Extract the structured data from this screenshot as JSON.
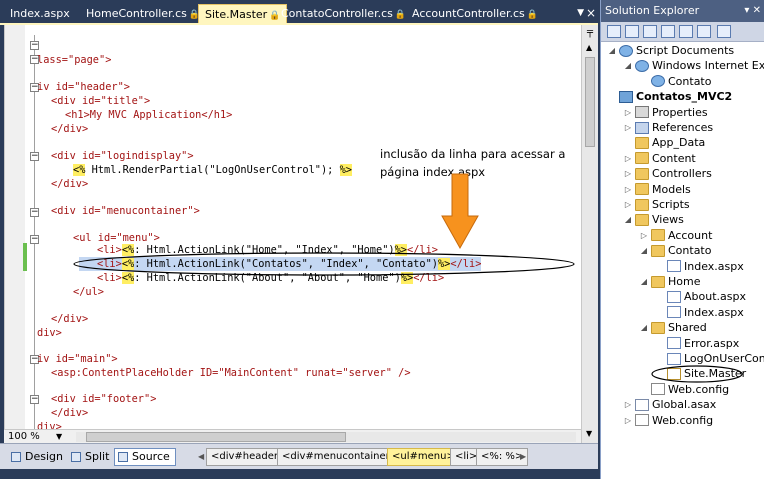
{
  "tabs": [
    {
      "label": "Index.aspx",
      "locked": false
    },
    {
      "label": "HomeController.cs",
      "locked": true
    },
    {
      "label": "Site.Master",
      "locked": true,
      "active": true
    },
    {
      "label": "ContatoController.cs",
      "locked": true
    },
    {
      "label": "AccountController.cs",
      "locked": true
    }
  ],
  "tab_lock_glyph": "🔒",
  "tab_dropdown_glyph": "▼",
  "tab_close_glyph": "×",
  "code": {
    "l1_a": "lass=\"page\">",
    "l2_a": "iv id=\"header\">",
    "l3_a": "<div id=\"title\">",
    "l4_a": "<h1>My MVC Application</h1>",
    "l5_a": "</div>",
    "l6_a": "<div id=\"logindisplay\">",
    "l7_open": "<%",
    "l7_mid": " Html.RenderPartial(\"LogOnUserControl\"); ",
    "l7_close": "%>",
    "l8_a": "</div>",
    "l9_a": "<div id=\"menucontainer\">",
    "l10_a": "<ul id=\"menu\">",
    "l11_pre": "<li>",
    "l11_open": "<%",
    "l11_mid": ": Html.ActionLink(\"Home\", \"Index\", \"Home\")",
    "l11_close": "%>",
    "l11_post": "</li>",
    "l12_pre": "<li>",
    "l12_open": "<%",
    "l12_mid": ": Html.ActionLink(\"Contatos\", \"Index\", \"Contato\")",
    "l12_close": "%>",
    "l12_post": "</li>",
    "l13_pre": "<li>",
    "l13_open": "<%",
    "l13_mid": ": Html.ActionLink(\"About\", \"About\", \"Home\")",
    "l13_close": "%>",
    "l13_post": "</li>",
    "l14_a": "</ul>",
    "l15_a": "</div>",
    "l16_a": "div>",
    "l17_a": "iv id=\"main\">",
    "l18_a": "<asp:ContentPlaceHolder ID=\"MainContent\" runat=\"server\" />",
    "l19_a": "<div id=\"footer\">",
    "l20_a": "</div>",
    "l21_a": "div>"
  },
  "annotation": {
    "line1": "inclusão da linha para acessar a",
    "line2": "página index.aspx"
  },
  "zoom": "100 %",
  "views": [
    {
      "label": "Design"
    },
    {
      "label": "Split"
    },
    {
      "label": "Source",
      "active": true
    }
  ],
  "breadcrumbs": [
    "<div#header>",
    "<div#menucontainer>",
    "<ul#menu>",
    "<li>",
    "<%: %>"
  ],
  "solution_explorer": {
    "title": "Solution Explorer",
    "pin_glyph": "▾ ✕",
    "tree": [
      {
        "label": "Script Documents",
        "icon": "globe",
        "level": 0,
        "exp": "−"
      },
      {
        "label": "Windows Internet Explorer",
        "icon": "globe",
        "level": 1,
        "exp": "−"
      },
      {
        "label": "Contato",
        "icon": "globe",
        "level": 2,
        "exp": ""
      },
      {
        "label": "Contatos_MVC2",
        "icon": "proj",
        "level": 0,
        "exp": "",
        "bold": true
      },
      {
        "label": "Properties",
        "icon": "props",
        "level": 1,
        "exp": "+"
      },
      {
        "label": "References",
        "icon": "refs",
        "level": 1,
        "exp": "+"
      },
      {
        "label": "App_Data",
        "icon": "folder",
        "level": 1,
        "exp": ""
      },
      {
        "label": "Content",
        "icon": "folder",
        "level": 1,
        "exp": "+"
      },
      {
        "label": "Controllers",
        "icon": "folder",
        "level": 1,
        "exp": "+"
      },
      {
        "label": "Models",
        "icon": "folder",
        "level": 1,
        "exp": "+"
      },
      {
        "label": "Scripts",
        "icon": "folder",
        "level": 1,
        "exp": "+"
      },
      {
        "label": "Views",
        "icon": "folder",
        "level": 1,
        "exp": "−"
      },
      {
        "label": "Account",
        "icon": "folder",
        "level": 2,
        "exp": "+"
      },
      {
        "label": "Contato",
        "icon": "folder",
        "level": 2,
        "exp": "−"
      },
      {
        "label": "Index.aspx",
        "icon": "aspx",
        "level": 3,
        "exp": ""
      },
      {
        "label": "Home",
        "icon": "folder",
        "level": 2,
        "exp": "−"
      },
      {
        "label": "About.aspx",
        "icon": "aspx",
        "level": 3,
        "exp": ""
      },
      {
        "label": "Index.aspx",
        "icon": "aspx",
        "level": 3,
        "exp": ""
      },
      {
        "label": "Shared",
        "icon": "folder",
        "level": 2,
        "exp": "−"
      },
      {
        "label": "Error.aspx",
        "icon": "aspx",
        "level": 3,
        "exp": ""
      },
      {
        "label": "LogOnUserControl",
        "icon": "aspx",
        "level": 3,
        "exp": ""
      },
      {
        "label": "Site.Master",
        "icon": "master",
        "level": 3,
        "exp": ""
      },
      {
        "label": "Web.config",
        "icon": "cfg",
        "level": 2,
        "exp": ""
      },
      {
        "label": "Global.asax",
        "icon": "file",
        "level": 1,
        "exp": "+"
      },
      {
        "label": "Web.config",
        "icon": "cfg",
        "level": 1,
        "exp": "+"
      }
    ]
  },
  "colors": {
    "tag": "#a31515",
    "attr": "#ff0000",
    "string": "#0000ff",
    "aspx_highlight": "#ffee62",
    "arrow": "#f7921e",
    "header_bg": "#4d6082"
  }
}
